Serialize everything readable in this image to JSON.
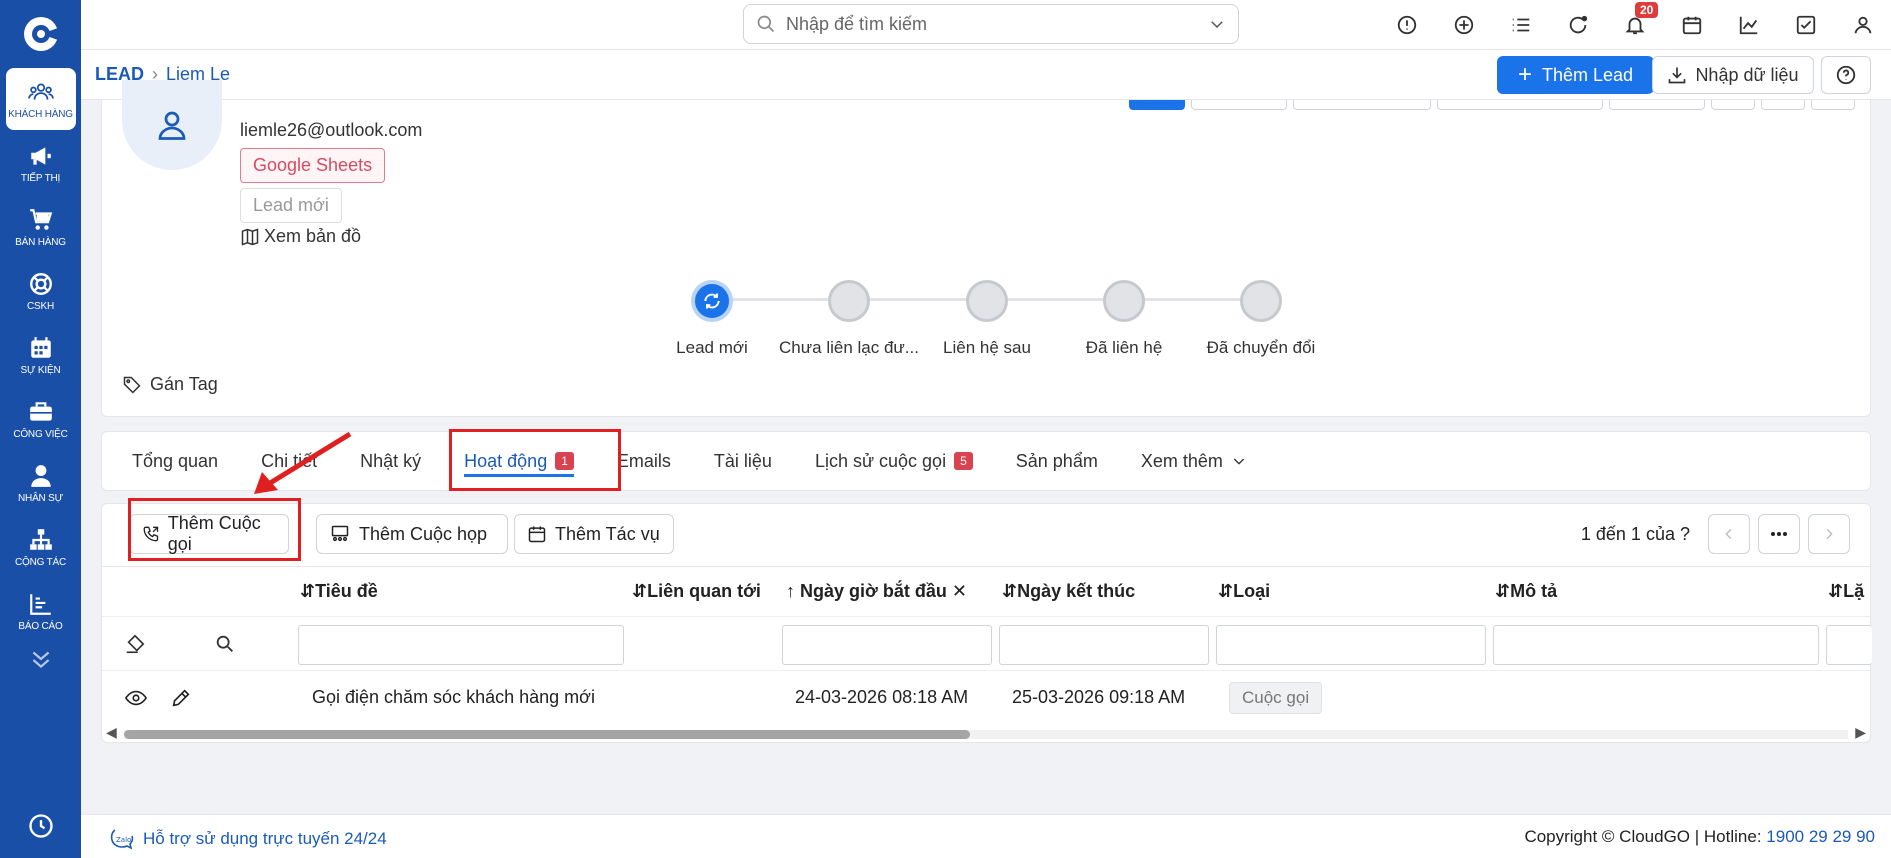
{
  "sidebar": {
    "items": [
      {
        "label": "KHÁCH HÀNG",
        "icon": "users-icon",
        "active": true
      },
      {
        "label": "TIẾP THỊ",
        "icon": "megaphone-icon"
      },
      {
        "label": "BÁN HÀNG",
        "icon": "cart-icon"
      },
      {
        "label": "CSKH",
        "icon": "lifebuoy-icon"
      },
      {
        "label": "SỰ KIỆN",
        "icon": "calendar-icon"
      },
      {
        "label": "CÔNG VIỆC",
        "icon": "briefcase-icon"
      },
      {
        "label": "NHÂN SỰ",
        "icon": "person-icon"
      },
      {
        "label": "CỘNG TÁC",
        "icon": "org-chart-icon"
      },
      {
        "label": "BÁO CÁO",
        "icon": "report-icon"
      }
    ]
  },
  "topbar": {
    "search_placeholder": "Nhập để tìm kiếm",
    "notification_count": "20"
  },
  "breadcrumb": {
    "root": "LEAD",
    "current": "Liem Le"
  },
  "header_actions": {
    "add_lead": "Thêm Lead",
    "import": "Nhập dữ liệu"
  },
  "profile": {
    "email": "liemle26@outlook.com",
    "source_tag": "Google Sheets",
    "status_tag": "Lead mới",
    "map_link": "Xem bản đồ",
    "assign_tag": "Gán Tag"
  },
  "stages": [
    {
      "label": "Lead mới",
      "active": true
    },
    {
      "label": "Chưa liên lạc đư..."
    },
    {
      "label": "Liên hệ sau"
    },
    {
      "label": "Đã liên hệ"
    },
    {
      "label": "Đã chuyển đổi"
    }
  ],
  "tabs": [
    {
      "label": "Tổng quan"
    },
    {
      "label": "Chi tiết"
    },
    {
      "label": "Nhật ký"
    },
    {
      "label": "Hoạt động",
      "badge": "1",
      "active": true
    },
    {
      "label": "Emails"
    },
    {
      "label": "Tài liệu"
    },
    {
      "label": "Lịch sử cuộc gọi",
      "badge": "5"
    },
    {
      "label": "Sản phẩm"
    },
    {
      "label": "Xem thêm"
    }
  ],
  "activity": {
    "add_call": "Thêm Cuộc gọi",
    "add_meeting": "Thêm Cuộc họp",
    "add_task": "Thêm Tác vụ",
    "pager_text": "1 đến 1 của",
    "pager_unknown": "?",
    "columns": [
      "Tiêu đề",
      "Liên quan tới",
      "Ngày giờ bắt đầu",
      "Ngày kết thúc",
      "Loại",
      "Mô tả",
      "Lặ"
    ],
    "rows": [
      {
        "title": "Gọi điện chăm sóc khách hàng mới",
        "related": "",
        "start": "24-03-2026 08:18 AM",
        "end": "25-03-2026 09:18 AM",
        "type": "Cuộc gọi",
        "desc": ""
      }
    ]
  },
  "footer": {
    "support": "Hỗ trợ sử dụng trực tuyến 24/24",
    "copyright": "Copyright © CloudGO",
    "hotline_label": "Hotline:",
    "hotline": "1900 29 29 90"
  },
  "colors": {
    "sidebar": "#1a4fa8",
    "primary": "#1a73e8",
    "highlight": "#e02020"
  }
}
